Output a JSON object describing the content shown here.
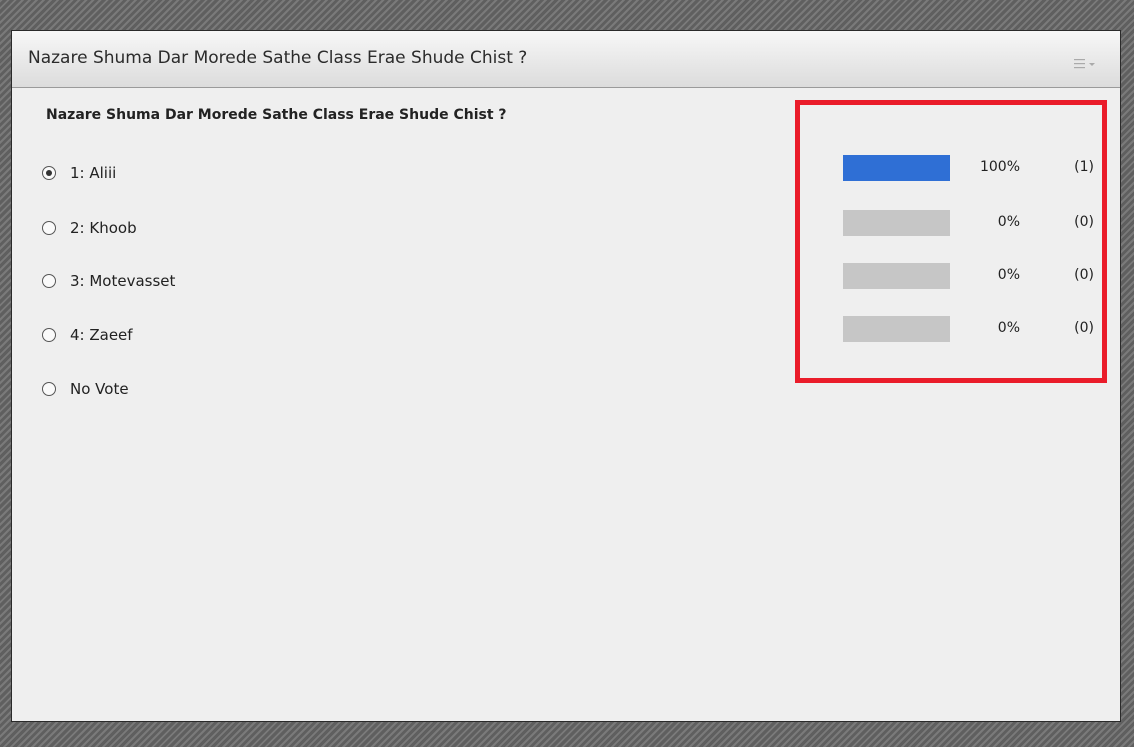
{
  "pod": {
    "title": "Nazare Shuma Dar Morede Sathe Class Erae Shude Chist ?",
    "menu_icon": "options-menu-icon"
  },
  "poll": {
    "question": "Nazare Shuma Dar Morede Sathe Class Erae Shude Chist ?",
    "selected_index": 0,
    "options": [
      {
        "label": "1: Aliii"
      },
      {
        "label": "2: Khoob"
      },
      {
        "label": "3: Motevasset"
      },
      {
        "label": "4: Zaeef"
      },
      {
        "label": "No Vote"
      }
    ]
  },
  "results": [
    {
      "fraction": 1.0,
      "percent_label": "100%",
      "count_label": "(1)"
    },
    {
      "fraction": 0.0,
      "percent_label": "0%",
      "count_label": "(0)"
    },
    {
      "fraction": 0.0,
      "percent_label": "0%",
      "count_label": "(0)"
    },
    {
      "fraction": 0.0,
      "percent_label": "0%",
      "count_label": "(0)"
    }
  ],
  "colors": {
    "bar_fill": "#2f6fd5",
    "bar_track": "#c6c6c6",
    "highlight_frame": "#ea1c2a"
  }
}
